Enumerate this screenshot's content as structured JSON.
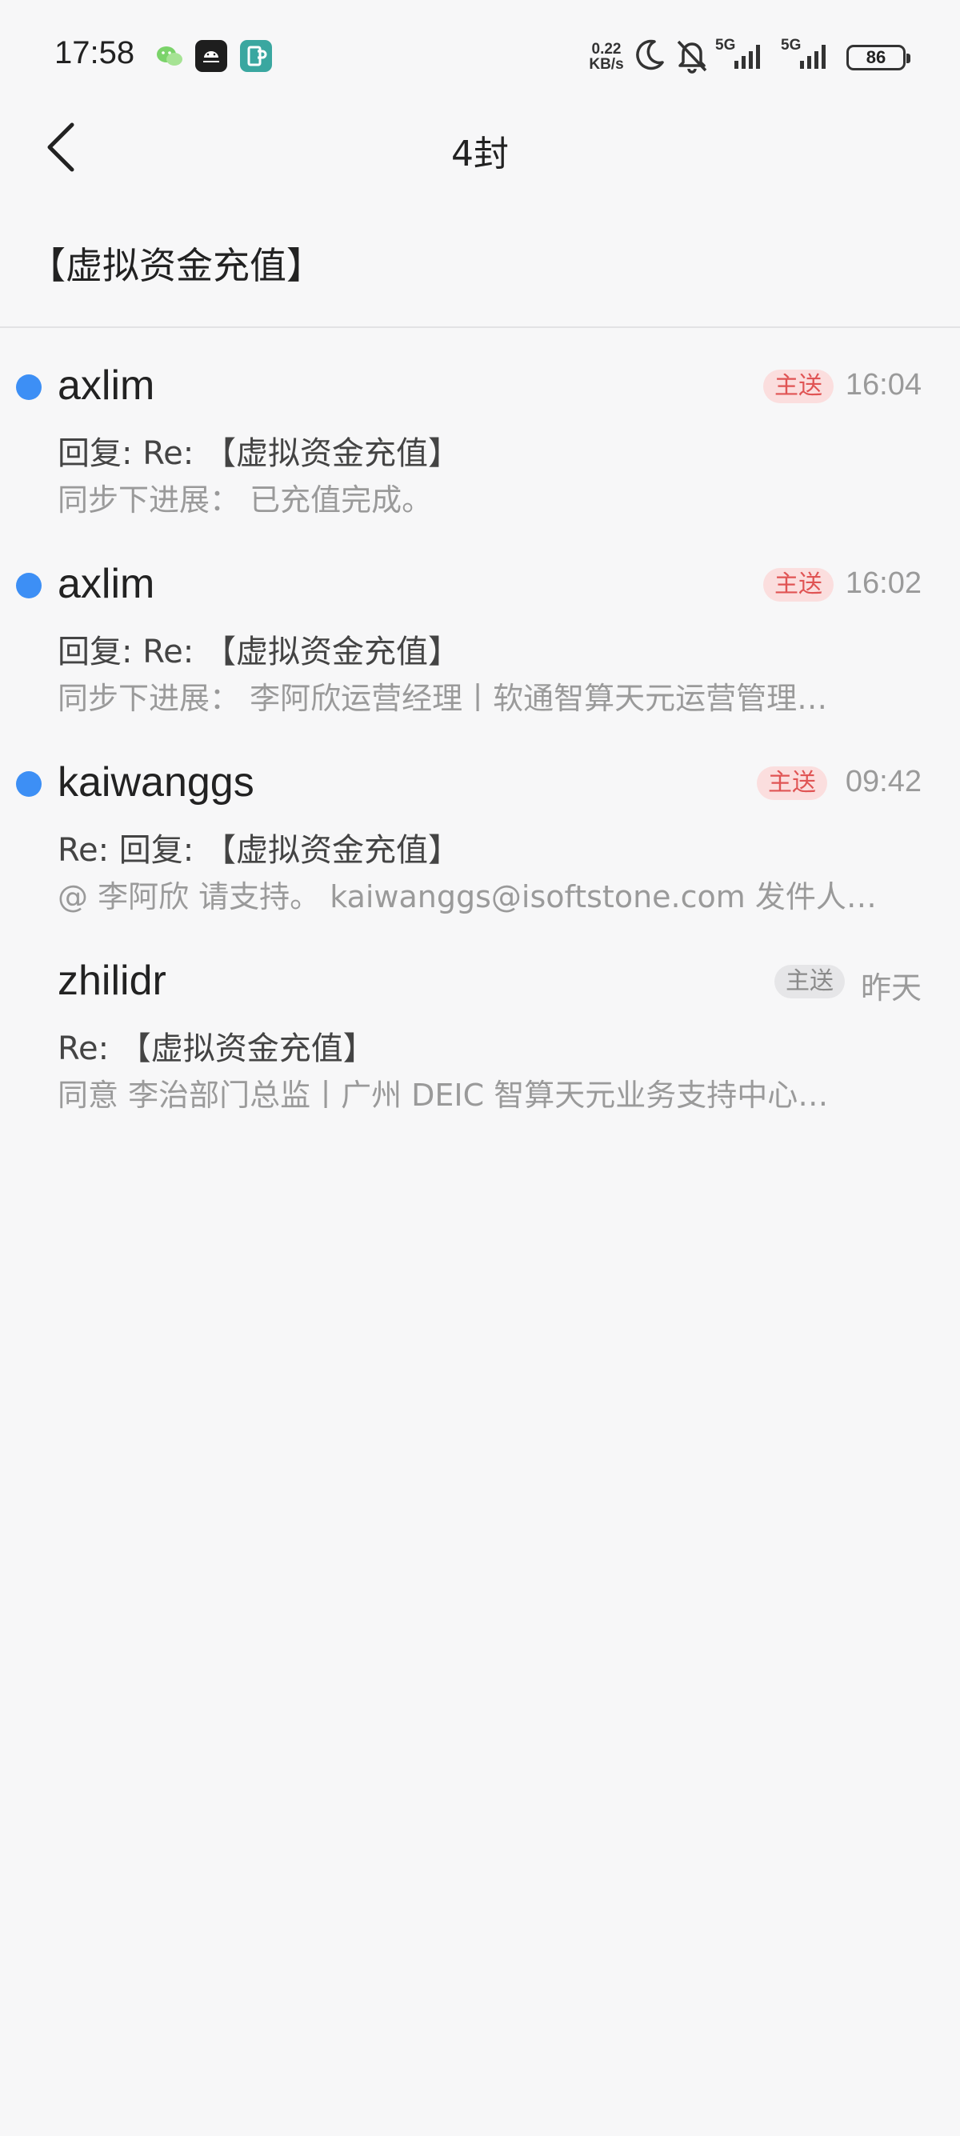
{
  "status_bar": {
    "time": "17:58",
    "net_speed_value": "0.22",
    "net_speed_unit": "KB/s",
    "battery": "86",
    "signal_1": "5G",
    "signal_2": "5G",
    "icons": [
      "wechat-icon",
      "android-app-icon",
      "parking-app-icon",
      "moon-icon",
      "bell-off-icon",
      "signal-icon",
      "battery-icon"
    ]
  },
  "nav": {
    "title": "4封"
  },
  "thread": {
    "subject": "【虚拟资金充值】"
  },
  "mails": [
    {
      "sender": "axlim",
      "subject": "回复: Re: 【虚拟资金充值】",
      "preview": "同步下进展：  已充值完成。",
      "badge": "主送",
      "time": "16:04",
      "unread": true,
      "badge_style": "red"
    },
    {
      "sender": "axlim",
      "subject": "回复: Re: 【虚拟资金充值】",
      "preview": "同步下进展：  李阿欣运营经理丨软通智算天元运营管理…",
      "badge": "主送",
      "time": "16:02",
      "unread": true,
      "badge_style": "red"
    },
    {
      "sender": "kaiwanggs",
      "subject": "Re: 回复: 【虚拟资金充值】",
      "preview": "@ 李阿欣 请支持。 kaiwanggs@isoftstone.com 发件人…",
      "badge": "主送",
      "time": "09:42",
      "unread": true,
      "badge_style": "red"
    },
    {
      "sender": "zhilidr",
      "subject": "Re: 【虚拟资金充值】",
      "preview": "同意 李治部门总监丨广州 DEIC 智算天元业务支持中心…",
      "badge": "主送",
      "time": "昨天",
      "unread": false,
      "badge_style": "gray"
    }
  ],
  "colors": {
    "background": "#f7f7f8",
    "unread_dot": "#3d8ff5",
    "badge_red_bg": "#fbdede",
    "badge_red_text": "#e05454",
    "badge_gray_bg": "#e6e6e8",
    "meta_text": "#9a9a9a"
  }
}
